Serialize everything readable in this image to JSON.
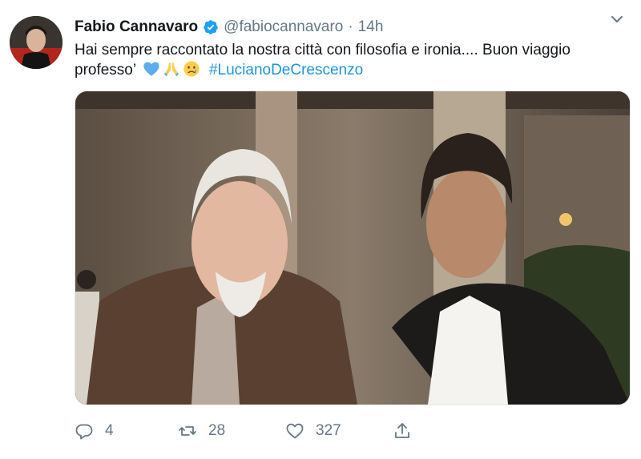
{
  "user": {
    "display_name": "Fabio Cannavaro",
    "handle": "@fabiocannavaro",
    "separator": "·",
    "time": "14h",
    "verified": true
  },
  "tweet": {
    "line1": "Hai sempre raccontato la nostra città con filosofia e ironia.... Buon viaggio",
    "line2_text": "professo’",
    "emojis": [
      "blue-heart",
      "folded-hands",
      "crying-face"
    ],
    "hashtag": "#LucianoDeCrescenzo"
  },
  "actions": {
    "replies": "4",
    "retweets": "28",
    "likes": "327"
  },
  "colors": {
    "link": "#1b95e0",
    "muted": "#657786",
    "verified": "#1da1f2"
  }
}
